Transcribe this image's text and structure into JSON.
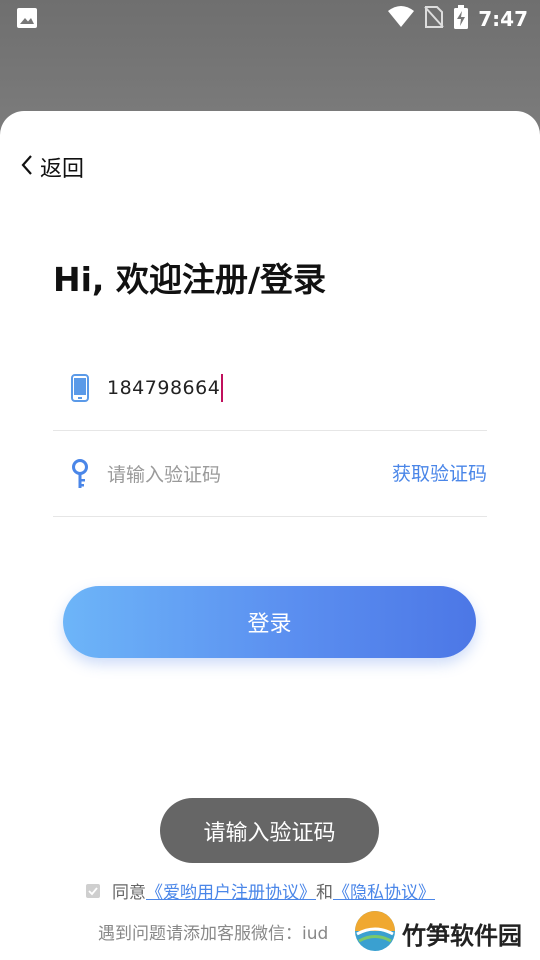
{
  "status_bar": {
    "time": "7:47",
    "icons": [
      "image-icon",
      "wifi-icon",
      "no-sim-icon",
      "battery-charging-icon"
    ]
  },
  "nav": {
    "back_label": "返回"
  },
  "headline": "Hi, 欢迎注册/登录",
  "phone": {
    "value": "184798664",
    "icon": "phone-icon"
  },
  "code": {
    "placeholder": "请输入验证码",
    "get_code_label": "获取验证码",
    "icon": "key-icon"
  },
  "login_button": "登录",
  "toast": "请输入验证码",
  "agreement": {
    "prefix": "同意",
    "user_agreement": "《爱哟用户注册协议》",
    "conjunction": "和",
    "privacy": "《隐私协议》"
  },
  "contact": "遇到问题请添加客服微信：iud",
  "watermark": "竹笋软件园",
  "colors": {
    "accent": "#4a86e8",
    "button_start": "#6db5f8",
    "button_end": "#4c77e6",
    "caret": "#c0105c",
    "toast_bg": "#666666"
  }
}
